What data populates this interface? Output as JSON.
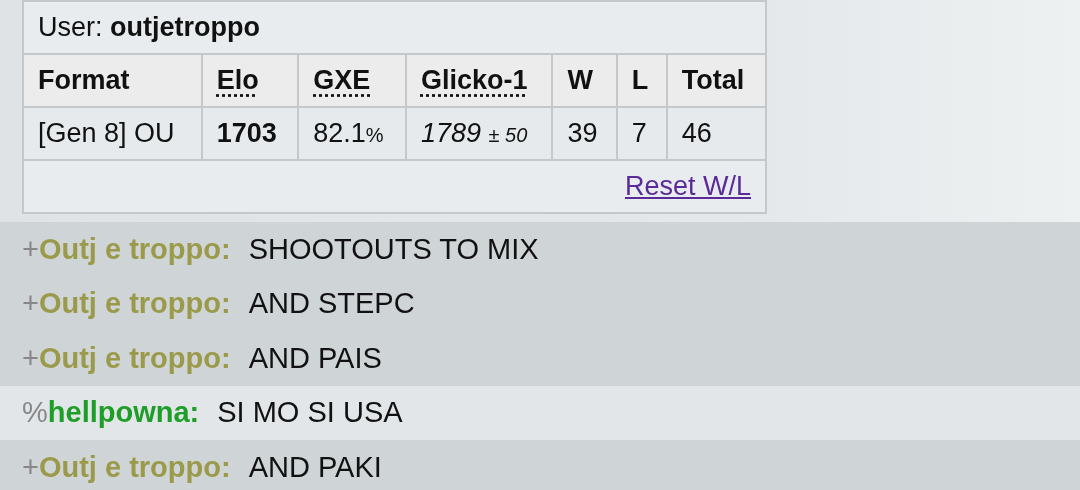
{
  "rank_card": {
    "user_label": "User:",
    "username": "outjetroppo",
    "columns": [
      {
        "label": "Format",
        "abbr": false
      },
      {
        "label": "Elo",
        "abbr": true
      },
      {
        "label": "GXE",
        "abbr": true
      },
      {
        "label": "Glicko-1",
        "abbr": true
      },
      {
        "label": "W",
        "abbr": false
      },
      {
        "label": "L",
        "abbr": false
      },
      {
        "label": "Total",
        "abbr": false
      }
    ],
    "rows": [
      {
        "format": "[Gen 8] OU",
        "elo": "1703",
        "gxe": "82.1",
        "gxe_unit": "%",
        "glicko": "1789",
        "glicko_deviation": "± 50",
        "wins": "39",
        "losses": "7",
        "total": "46"
      }
    ],
    "reset_link": "Reset W/L"
  },
  "messages": [
    {
      "rank": "+",
      "user": "Outj e troppo:",
      "color": "#9a9a4a",
      "text": "SHOOTOUTS TO MIX",
      "highlighted": true
    },
    {
      "rank": "+",
      "user": "Outj e troppo:",
      "color": "#9a9a4a",
      "text": "AND STEPC",
      "highlighted": true
    },
    {
      "rank": "+",
      "user": "Outj e troppo:",
      "color": "#9a9a4a",
      "text": "AND PAIS",
      "highlighted": true
    },
    {
      "rank": "%",
      "user": "hellpowna:",
      "color": "#1e9e28",
      "text": "SI MO SI USA",
      "highlighted": false
    },
    {
      "rank": "+",
      "user": "Outj e troppo:",
      "color": "#9a9a4a",
      "text": "AND PAKI",
      "highlighted": true
    }
  ]
}
